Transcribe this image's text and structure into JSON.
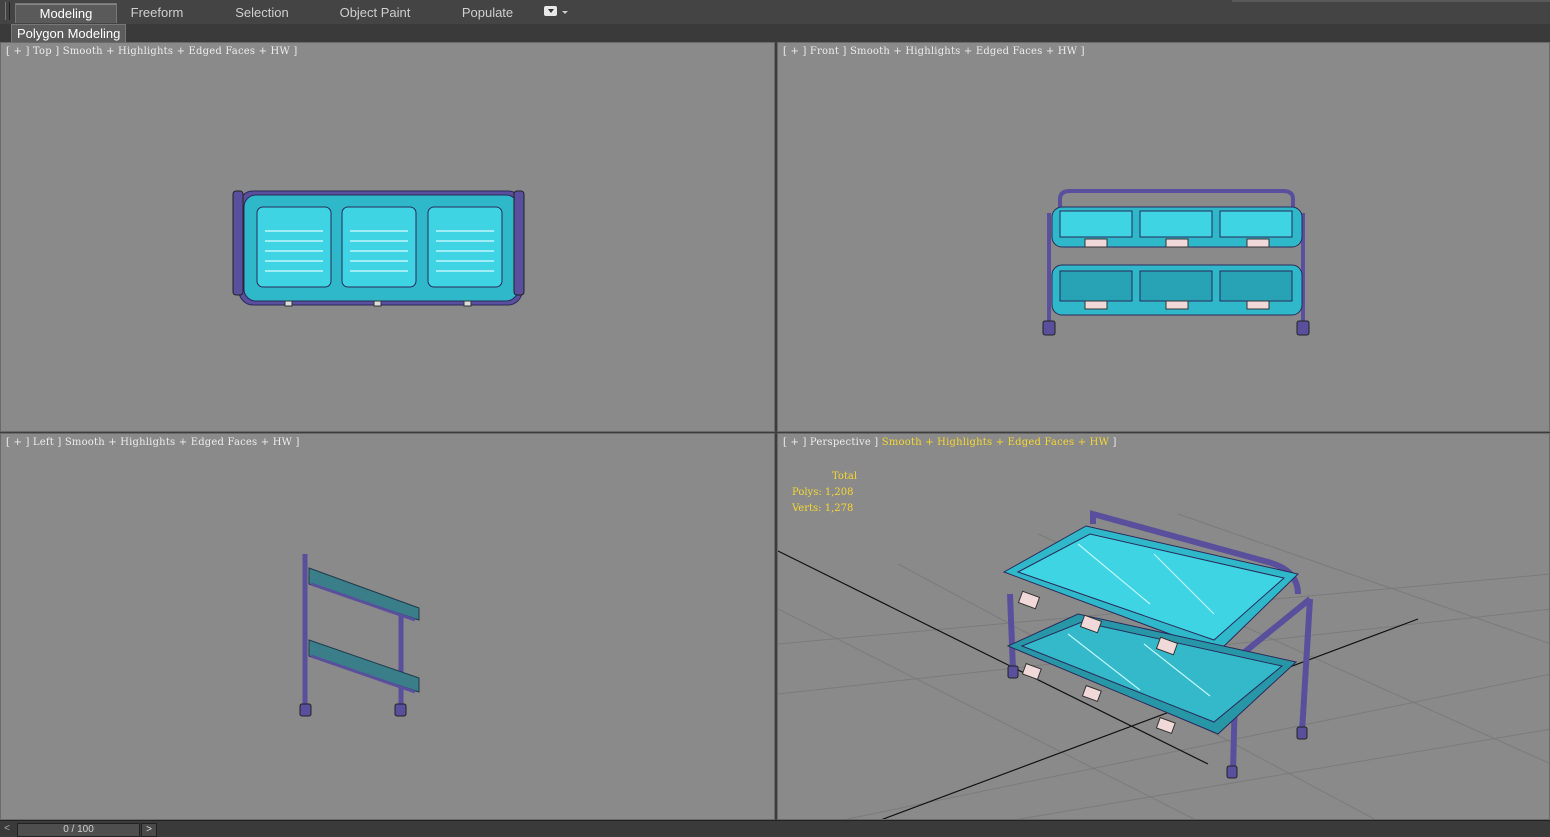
{
  "ribbon": {
    "tabs": [
      {
        "label": "Modeling",
        "active": true
      },
      {
        "label": "Freeform",
        "active": false
      },
      {
        "label": "Selection",
        "active": false
      },
      {
        "label": "Object Paint",
        "active": false
      },
      {
        "label": "Populate",
        "active": false
      }
    ],
    "dropdown_icon": "toggle-dropdown-icon"
  },
  "subbar": {
    "label": "Polygon Modeling"
  },
  "viewports": {
    "top": {
      "label": "[ + ] Top ] Smooth + Highlights + Edged Faces + HW ]"
    },
    "front": {
      "label": "[ + ] Front ] Smooth + Highlights + Edged Faces + HW ]"
    },
    "left": {
      "label": "[ + ] Left ] Smooth + Highlights + Edged Faces + HW ]"
    },
    "perspective": {
      "label_prefix": "[ + ] Perspective ] ",
      "label_shading": "Smooth + Highlights + Edged Faces + HW",
      "label_suffix": " ]",
      "stats": {
        "total": "Total",
        "polys": "Polys: 1,208",
        "verts": "Verts: 1,278"
      }
    }
  },
  "timeline": {
    "prev": "<",
    "frame": "0 / 100",
    "next": ">"
  },
  "colors": {
    "viewport_bg": "#8a8a8a",
    "mesh_cyan": "#3fd4e4",
    "frame_purple": "#5a4f9c",
    "highlight_yellow": "#f5d733"
  }
}
